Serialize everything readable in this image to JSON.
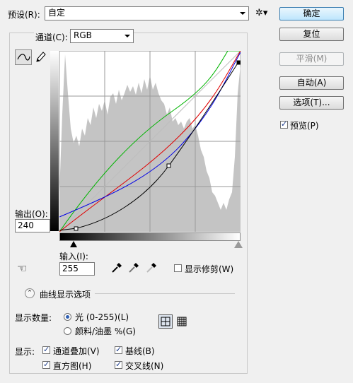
{
  "preset": {
    "label": "预设(R):",
    "value": "自定"
  },
  "buttons": {
    "ok": "确定",
    "reset": "复位",
    "smooth": "平滑(M)",
    "auto": "自动(A)",
    "options": "选项(T)..."
  },
  "preview": {
    "label": "预览(P)",
    "checked": true
  },
  "channel": {
    "label": "通道(C):",
    "value": "RGB"
  },
  "output": {
    "label": "输出(O):",
    "value": "240"
  },
  "input": {
    "label": "输入(I):",
    "value": "255"
  },
  "show_clipping": {
    "label": "显示修剪(W)",
    "checked": false
  },
  "curve_options": {
    "label": "曲线显示选项"
  },
  "show_amount": {
    "label": "显示数量:",
    "light": "光 (0-255)(L)",
    "pigment": "颜料/油墨 %(G)",
    "selected": "light"
  },
  "show": {
    "label": "显示:",
    "channel_overlays": "通道叠加(V)",
    "baseline": "基线(B)",
    "histogram": "直方图(H)",
    "intersection": "交叉线(N)"
  },
  "colors": {
    "green": "#00b400",
    "red": "#e00000",
    "blue": "#0000e6",
    "histogram": "#c4c4c4"
  }
}
